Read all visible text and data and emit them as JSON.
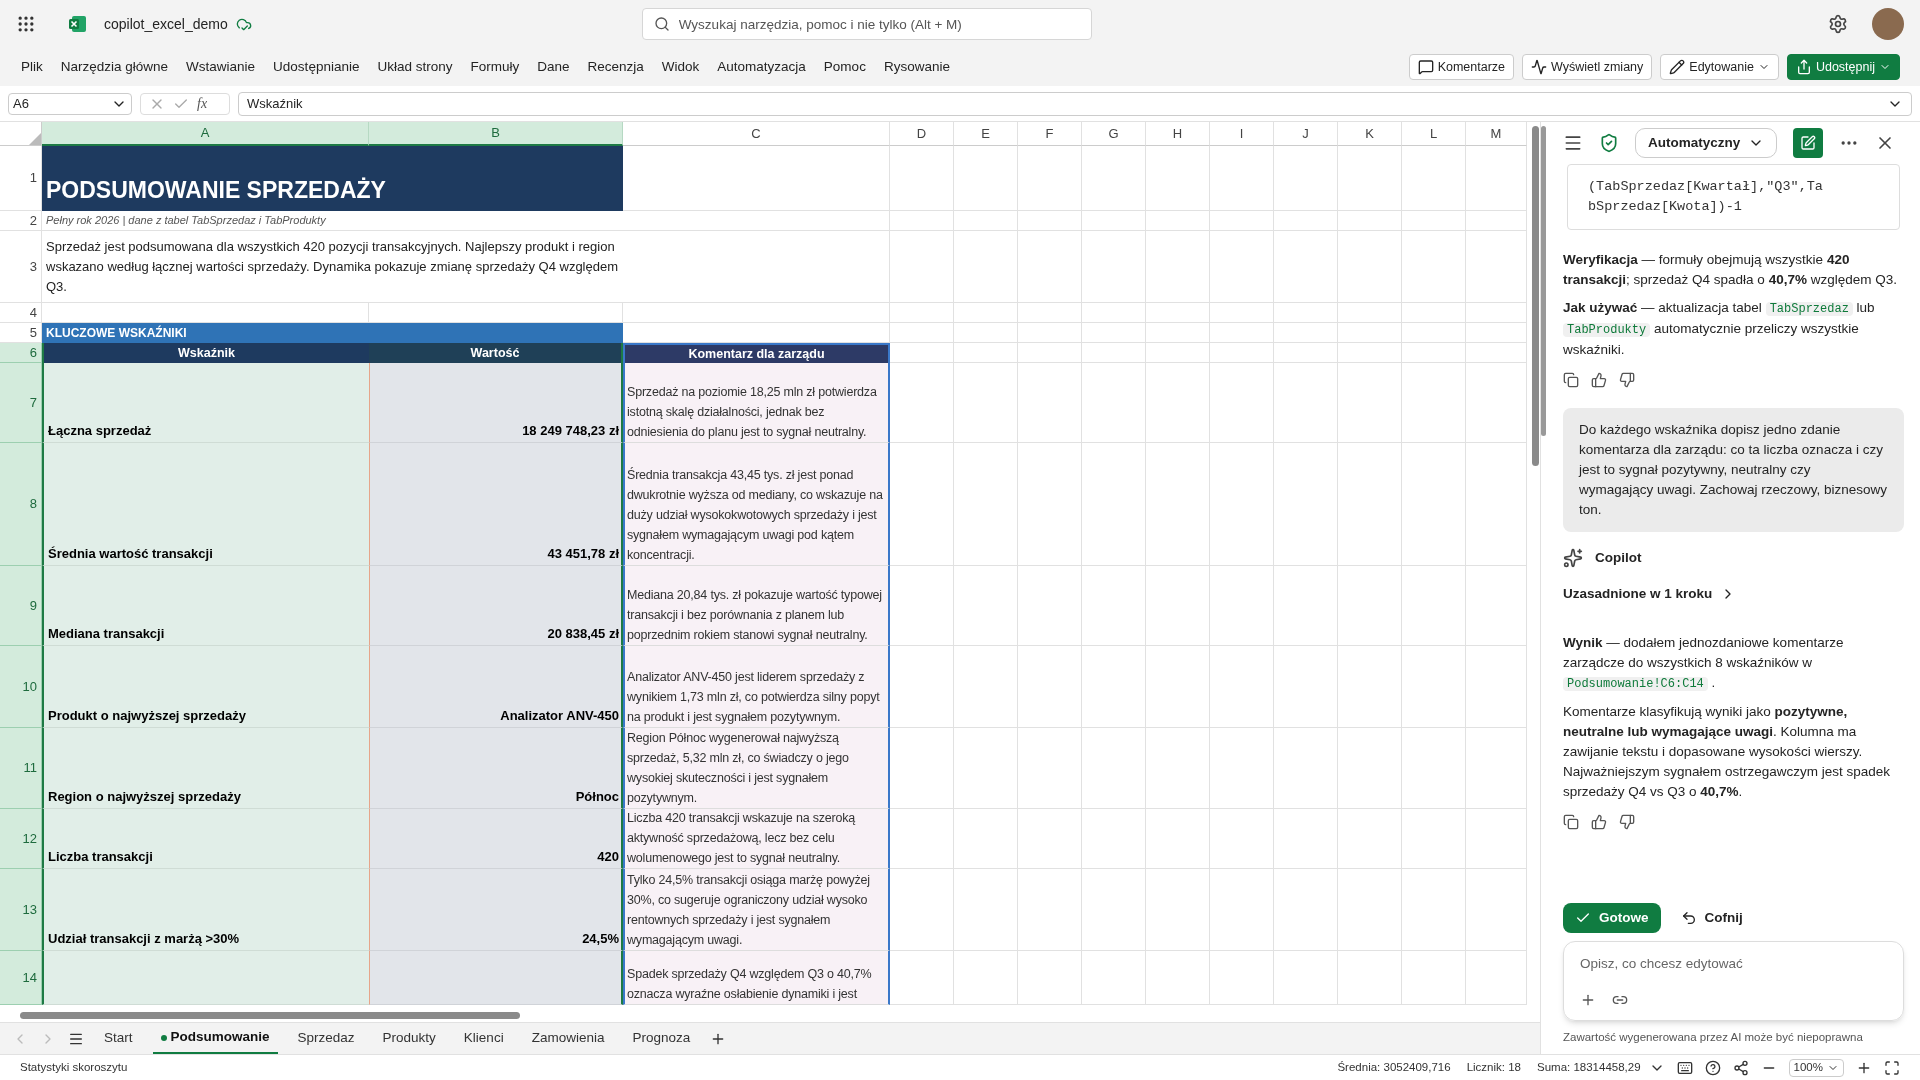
{
  "app": {
    "file_name": "copilot_excel_demo",
    "search_placeholder": "Wyszukaj narzędzia, pomoc i nie tylko (Alt + M)"
  },
  "menu": [
    "Plik",
    "Narzędzia główne",
    "Wstawianie",
    "Udostępnianie",
    "Układ strony",
    "Formuły",
    "Dane",
    "Recenzja",
    "Widok",
    "Automatyzacja",
    "Pomoc",
    "Rysowanie"
  ],
  "ribbon_buttons": [
    {
      "kind": "comments",
      "label": "Komentarze"
    },
    {
      "kind": "changes",
      "label": "Wyświetl zmiany"
    },
    {
      "kind": "editing",
      "label": "Edytowanie"
    },
    {
      "kind": "share",
      "label": "Udostępnij"
    }
  ],
  "formula_bar": {
    "name_box": "A6",
    "function_label": "fx",
    "value": "Wskaźnik"
  },
  "columns": [
    {
      "letter": "A",
      "selected": true
    },
    {
      "letter": "B",
      "selected": true
    },
    {
      "letter": "C",
      "selected": false
    },
    {
      "letter": "D",
      "selected": false
    },
    {
      "letter": "E",
      "selected": false
    },
    {
      "letter": "F",
      "selected": false
    },
    {
      "letter": "G",
      "selected": false
    },
    {
      "letter": "H",
      "selected": false
    },
    {
      "letter": "I",
      "selected": false
    },
    {
      "letter": "J",
      "selected": false
    },
    {
      "letter": "K",
      "selected": false
    },
    {
      "letter": "L",
      "selected": false
    },
    {
      "letter": "M",
      "selected": false
    }
  ],
  "rows": [
    {
      "number": "1",
      "selected": false,
      "kind": "title",
      "text": "PODSUMOWANIE SPRZEDAŻY"
    },
    {
      "number": "2",
      "selected": false,
      "kind": "subtitle",
      "text": "Pełny rok 2026 | dane z tabel TabSprzedaz i TabProdukty"
    },
    {
      "number": "3",
      "selected": false,
      "kind": "description",
      "text": "Sprzedaż jest podsumowana dla wszystkich 420 pozycji transakcyjnych. Najlepszy produkt i region wskazano według łącznej wartości sprzedaży. Dynamika pokazuje zmianę sprzedaży Q4 względem Q3."
    },
    {
      "number": "4",
      "selected": false,
      "kind": "blank"
    },
    {
      "number": "5",
      "selected": false,
      "kind": "section",
      "text": "KLUCZOWE WSKAŹNIKI"
    },
    {
      "number": "6",
      "selected": true,
      "kind": "header",
      "cells": [
        "Wskaźnik",
        "Wartość",
        "Komentarz dla zarządu"
      ]
    },
    {
      "number": "7",
      "selected": true,
      "kind": "metric",
      "name": "Łączna sprzedaż",
      "value": "18 249 748,23 zł",
      "comment": "Sprzedaż na poziomie 18,25 mln zł potwierdza istotną skalę działalności, jednak bez odniesienia do planu jest to sygnał neutralny."
    },
    {
      "number": "8",
      "selected": true,
      "kind": "metric",
      "name": "Średnia wartość transakcji",
      "value": "43 451,78 zł",
      "comment": "Średnia transakcja 43,45 tys. zł jest ponad dwukrotnie wyższa od mediany, co wskazuje na duży udział wysokokwotowych sprzedaży i jest sygnałem wymagającym uwagi pod kątem koncentracji."
    },
    {
      "number": "9",
      "selected": true,
      "kind": "metric",
      "name": "Mediana transakcji",
      "value": "20 838,45 zł",
      "comment": "Mediana 20,84 tys. zł pokazuje wartość typowej transakcji i bez porównania z planem lub poprzednim rokiem stanowi sygnał neutralny."
    },
    {
      "number": "10",
      "selected": true,
      "kind": "metric",
      "name": "Produkt o najwyższej sprzedaży",
      "value": "Analizator ANV-450",
      "comment": "Analizator ANV-450 jest liderem sprzedaży z wynikiem 1,73 mln zł, co potwierdza silny popyt na produkt i jest sygnałem pozytywnym."
    },
    {
      "number": "11",
      "selected": true,
      "kind": "metric",
      "name": "Region o najwyższej sprzedaży",
      "value": "Północ",
      "comment": "Region Północ wygenerował najwyższą sprzedaż, 5,32 mln zł, co świadczy o jego wysokiej skuteczności i jest sygnałem pozytywnym."
    },
    {
      "number": "12",
      "selected": true,
      "kind": "metric",
      "name": "Liczba transakcji",
      "value": "420",
      "comment": "Liczba 420 transakcji wskazuje na szeroką aktywność sprzedażową, lecz bez celu wolumenowego jest to sygnał neutralny."
    },
    {
      "number": "13",
      "selected": true,
      "kind": "metric",
      "name": "Udział transakcji z marżą >30%",
      "value": "24,5%",
      "comment": "Tylko 24,5% transakcji osiąga marżę powyżej 30%, co sugeruje ograniczony udział wysoko rentownych sprzedaży i jest sygnałem wymagającym uwagi."
    },
    {
      "number": "14",
      "selected": true,
      "kind": "metric",
      "comment": "Spadek sprzedaży Q4 względem Q3 o 40,7% oznacza wyraźne osłabienie dynamiki i jest"
    }
  ],
  "copilot": {
    "mode_dropdown": "Automatyczny",
    "code_lines": [
      "(TabSprzedaz[Kwartał],\"Q3\",Ta",
      "bSprzedaz[Kwota])-1"
    ],
    "answer_1": [
      [
        {
          "kind": "text",
          "text": "**Weryfikacja** — formuły obejmują wszystkie **420 transakcji**; sprzedaż Q4 spadła o **40,7%** względem Q3."
        }
      ],
      [
        {
          "kind": "text",
          "text": "**Jak używać** — aktualizacja tabel "
        },
        {
          "kind": "code",
          "text": "TabSprzedaz"
        },
        {
          "kind": "text",
          "text": " lub "
        },
        {
          "kind": "code",
          "text": "TabProdukty"
        },
        {
          "kind": "text",
          "text": " automatycznie przeliczy wszystkie wskaźniki."
        }
      ]
    ],
    "user_message": "Do każdego wskaźnika dopisz jedno zdanie komentarza dla zarządu: co ta liczba oznacza i czy jest to sygnał pozytywny, neutralny czy wymagający uwagi. Zachowaj rzeczowy, biznesowy ton.",
    "author": "Copilot",
    "reasoning_link": "Uzasadnione w 1 kroku",
    "answer_2": [
      [
        {
          "kind": "text",
          "text": "**Wynik** — dodałem jednozdaniowe komentarze zarządcze do wszystkich 8 wskaźników w "
        },
        {
          "kind": "code",
          "text": "Podsumowanie!C6:C14"
        },
        {
          "kind": "text",
          "text": " ."
        }
      ],
      [
        {
          "kind": "text",
          "text": "Komentarze klasyfikują wyniki jako **pozytywne, neutralne lub wymagające uwagi**. Kolumna ma zawijanie tekstu i dopasowane wysokości wierszy. Najważniejszym sygnałem ostrzegawczym jest spadek sprzedaży Q4 vs Q3 o **40,7%**."
        }
      ]
    ],
    "actions": [
      {
        "kind": "accept",
        "label": "Gotowe"
      },
      {
        "kind": "undo",
        "label": "Cofnij"
      }
    ],
    "prompt_placeholder": "Opisz, co chcesz edytować",
    "disclaimer": "Zawartość wygenerowana przez AI może być niepoprawna"
  },
  "sheet_tabs": [
    {
      "label": "Start",
      "selected": false
    },
    {
      "label": "Podsumowanie",
      "selected": true
    },
    {
      "label": "Sprzedaz",
      "selected": false
    },
    {
      "label": "Produkty",
      "selected": false
    },
    {
      "label": "Klienci",
      "selected": false
    },
    {
      "label": "Zamowienia",
      "selected": false
    },
    {
      "label": "Prognoza",
      "selected": false
    }
  ],
  "status_bar": {
    "left": "Statystyki skoroszytu",
    "average": "Średnia: 3052409,716",
    "count": "Licznik: 18",
    "sum": "Suma: 18314458,29",
    "zoom": "100%"
  }
}
